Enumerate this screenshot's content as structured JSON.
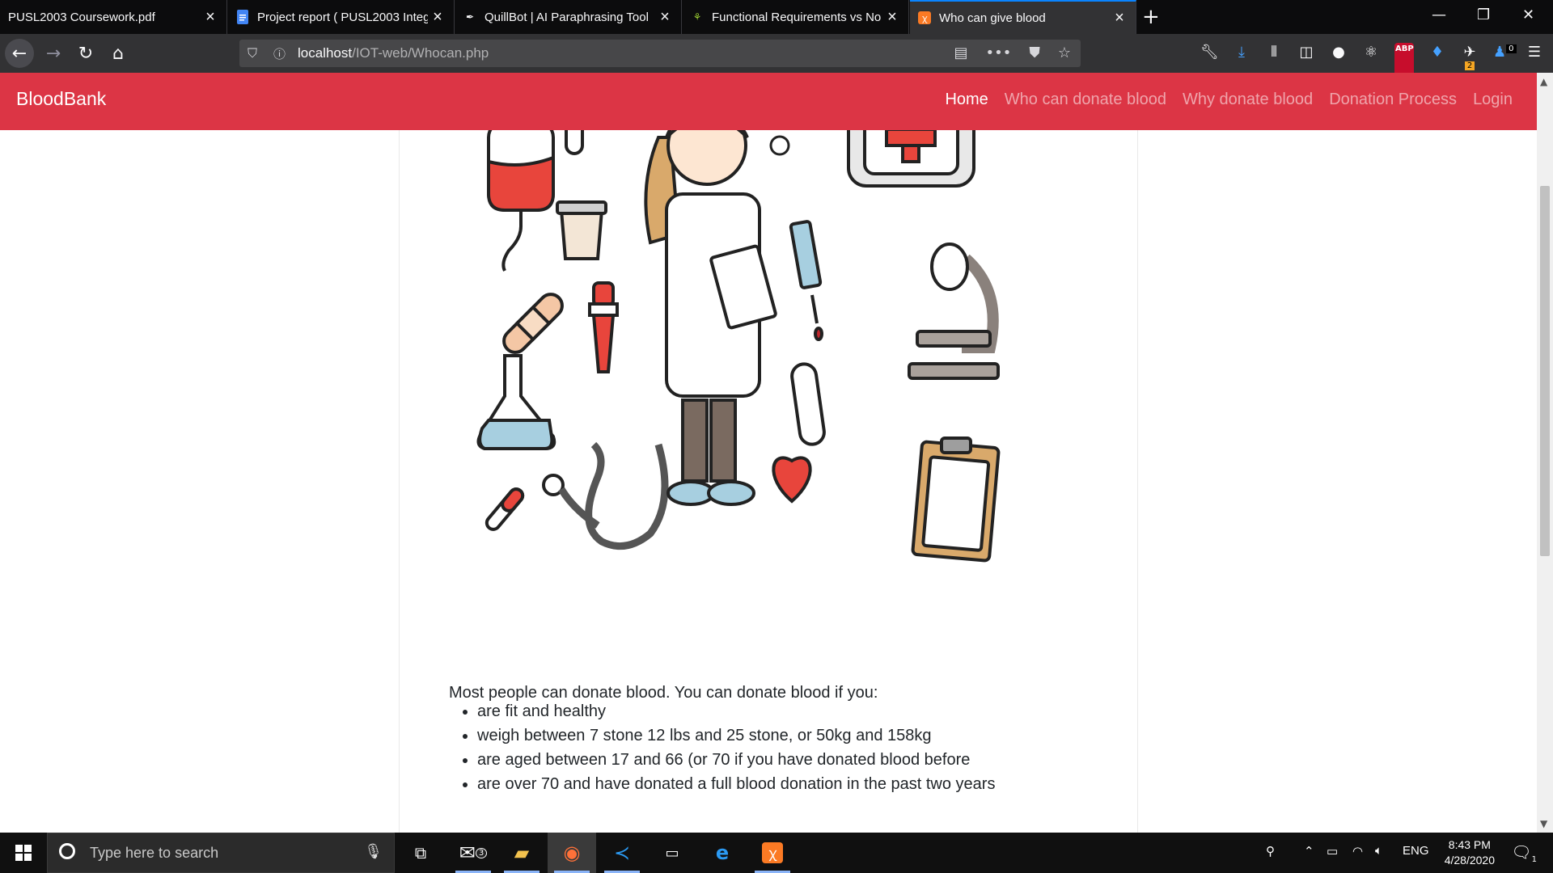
{
  "browser": {
    "tabs": [
      {
        "title": "PUSL2003 Coursework.pdf",
        "favicon": "pdf-icon",
        "active": false
      },
      {
        "title": "Project report ( PUSL2003 Integ",
        "favicon": "docs-icon",
        "active": false
      },
      {
        "title": "QuillBot | AI Paraphrasing Tool",
        "favicon": "quill-icon",
        "active": false
      },
      {
        "title": "Functional Requirements vs No",
        "favicon": "web-icon",
        "active": false
      },
      {
        "title": "Who can give blood",
        "favicon": "xampp-icon",
        "active": true
      }
    ],
    "url_host": "localhost",
    "url_path": "/IOT-web/Whocan.php",
    "accent": "#0a84ff",
    "badges": {
      "extension_count": "2",
      "notification_count": "0"
    }
  },
  "site": {
    "brand": "BloodBank",
    "brand_color": "#dc3545",
    "nav": [
      "Home",
      "Who can donate blood",
      "Why donate blood",
      "Donation Process",
      "Login"
    ],
    "active_nav": "Home"
  },
  "content": {
    "intro": "Most people can donate blood. You can donate blood if you:",
    "criteria": [
      "are fit and healthy",
      "weigh between 7 stone 12 lbs and 25 stone, or 50kg and 158kg",
      "are aged between 17 and 66 (or 70 if you have donated blood before",
      "are over 70 and have donated a full blood donation in the past two years"
    ]
  },
  "taskbar": {
    "search_placeholder": "Type here to search",
    "mail_badge": "3",
    "language": "ENG",
    "time": "8:43 PM",
    "date": "4/28/2020",
    "notification_count": "1"
  }
}
